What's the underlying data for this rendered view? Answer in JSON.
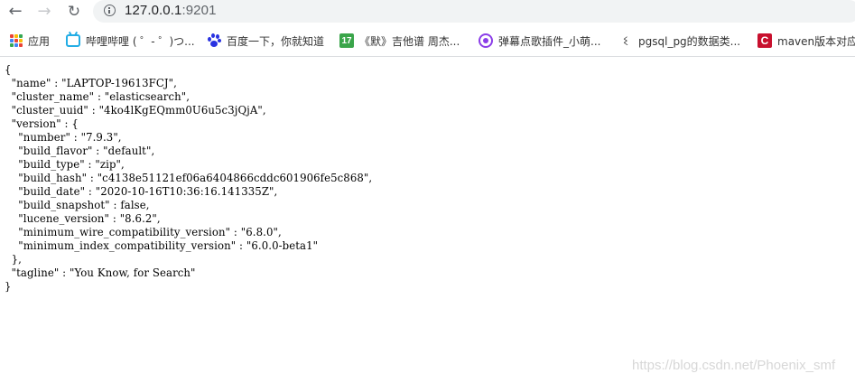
{
  "toolbar": {
    "back_icon": "arrow-left-icon",
    "forward_icon": "arrow-right-icon",
    "reload_icon": "reload-icon",
    "url_host": "127.0.0.1",
    "url_port": ":9201"
  },
  "bookmarks": [
    {
      "label": "应用",
      "icon": "apps-grid-icon"
    },
    {
      "label": "哔哩哔哩 ( ゜- ゜)つ...",
      "icon": "bilibili-icon"
    },
    {
      "label": "百度一下，你就知道",
      "icon": "baidu-paw-icon"
    },
    {
      "label": "《默》吉他谱 周杰...",
      "icon": "site-17-icon"
    },
    {
      "label": "弹幕点歌插件_小萌...",
      "icon": "music-icon"
    },
    {
      "label": "pgsql_pg的数据类...",
      "icon": "pg-icon"
    },
    {
      "label": "maven版本对应",
      "icon": "csdn-c-icon"
    }
  ],
  "json_text": "{\n  \"name\" : \"LAPTOP-19613FCJ\",\n  \"cluster_name\" : \"elasticsearch\",\n  \"cluster_uuid\" : \"4ko4lKgEQmm0U6u5c3jQjA\",\n  \"version\" : {\n    \"number\" : \"7.9.3\",\n    \"build_flavor\" : \"default\",\n    \"build_type\" : \"zip\",\n    \"build_hash\" : \"c4138e51121ef06a6404866cddc601906fe5c868\",\n    \"build_date\" : \"2020-10-16T10:36:16.141335Z\",\n    \"build_snapshot\" : false,\n    \"lucene_version\" : \"8.6.2\",\n    \"minimum_wire_compatibility_version\" : \"6.8.0\",\n    \"minimum_index_compatibility_version\" : \"6.0.0-beta1\"\n  },\n  \"tagline\" : \"You Know, for Search\"\n}",
  "watermark": "https://blog.csdn.net/Phoenix_smf",
  "colors": {
    "omnibox_bg": "#f1f3f4",
    "bilibili": "#23ade5",
    "baidu": "#2932e1",
    "site17": "#3aa54a",
    "music": "#8b3ee8",
    "csdn": "#c8102e"
  }
}
